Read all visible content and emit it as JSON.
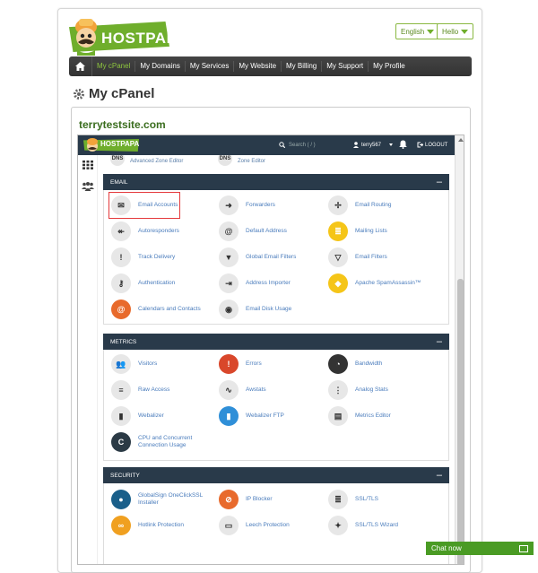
{
  "header": {
    "logo_text": "HOSTPAPA",
    "language": "English",
    "greeting": "Hello"
  },
  "nav": {
    "items": [
      {
        "label": "My cPanel",
        "active": true
      },
      {
        "label": "My Domains"
      },
      {
        "label": "My Services"
      },
      {
        "label": "My Website"
      },
      {
        "label": "My Billing"
      },
      {
        "label": "My Support"
      },
      {
        "label": "My Profile"
      }
    ]
  },
  "page": {
    "title": "My cPanel",
    "site_name": "terrytestsite.com"
  },
  "cpanel": {
    "logo_text": "HOSTPAPA",
    "search_placeholder": "Search ( / )",
    "user": "terry567",
    "logout": "LOGOUT",
    "hints": [
      {
        "icon": "DNS",
        "label": "Advanced Zone Editor"
      },
      {
        "icon": "DNS",
        "label": "Zone Editor"
      }
    ],
    "sections": {
      "email": {
        "title": "EMAIL",
        "items": [
          {
            "label": "Email Accounts",
            "icon": "email-accounts-icon"
          },
          {
            "label": "Forwarders",
            "icon": "forwarders-icon"
          },
          {
            "label": "Email Routing",
            "icon": "email-routing-icon"
          },
          {
            "label": "Autoresponders",
            "icon": "autoresponders-icon"
          },
          {
            "label": "Default Address",
            "icon": "default-address-icon"
          },
          {
            "label": "Mailing Lists",
            "icon": "mailing-lists-icon"
          },
          {
            "label": "Track Delivery",
            "icon": "track-delivery-icon"
          },
          {
            "label": "Global Email Filters",
            "icon": "global-email-filters-icon"
          },
          {
            "label": "Email Filters",
            "icon": "email-filters-icon"
          },
          {
            "label": "Authentication",
            "icon": "authentication-icon"
          },
          {
            "label": "Address Importer",
            "icon": "address-importer-icon"
          },
          {
            "label": "Apache SpamAssassin™",
            "icon": "spamassassin-icon"
          },
          {
            "label": "Calendars and Contacts",
            "icon": "calendars-contacts-icon"
          },
          {
            "label": "Email Disk Usage",
            "icon": "email-disk-usage-icon"
          }
        ]
      },
      "metrics": {
        "title": "METRICS",
        "items": [
          {
            "label": "Visitors",
            "icon": "visitors-icon"
          },
          {
            "label": "Errors",
            "icon": "errors-icon"
          },
          {
            "label": "Bandwidth",
            "icon": "bandwidth-icon"
          },
          {
            "label": "Raw Access",
            "icon": "raw-access-icon"
          },
          {
            "label": "Awstats",
            "icon": "awstats-icon"
          },
          {
            "label": "Analog Stats",
            "icon": "analog-stats-icon"
          },
          {
            "label": "Webalizer",
            "icon": "webalizer-icon"
          },
          {
            "label": "Webalizer FTP",
            "icon": "webalizer-ftp-icon"
          },
          {
            "label": "Metrics Editor",
            "icon": "metrics-editor-icon"
          },
          {
            "label": "CPU and Concurrent Connection Usage",
            "icon": "cpu-usage-icon"
          }
        ]
      },
      "security": {
        "title": "SECURITY",
        "items": [
          {
            "label": "GlobalSign OneClickSSL Installer",
            "icon": "globalsign-icon"
          },
          {
            "label": "IP Blocker",
            "icon": "ip-blocker-icon"
          },
          {
            "label": "SSL/TLS",
            "icon": "ssl-tls-icon"
          },
          {
            "label": "Hotlink Protection",
            "icon": "hotlink-protection-icon"
          },
          {
            "label": "Leech Protection",
            "icon": "leech-protection-icon"
          },
          {
            "label": "SSL/TLS Wizard",
            "icon": "ssl-tls-wizard-icon"
          }
        ]
      }
    }
  },
  "chat": {
    "label": "Chat now"
  },
  "colors": {
    "brand_green": "#6fae2c",
    "nav_dark": "#293a4a",
    "link_blue": "#4a7cbc",
    "highlight_red": "#e4393c"
  }
}
